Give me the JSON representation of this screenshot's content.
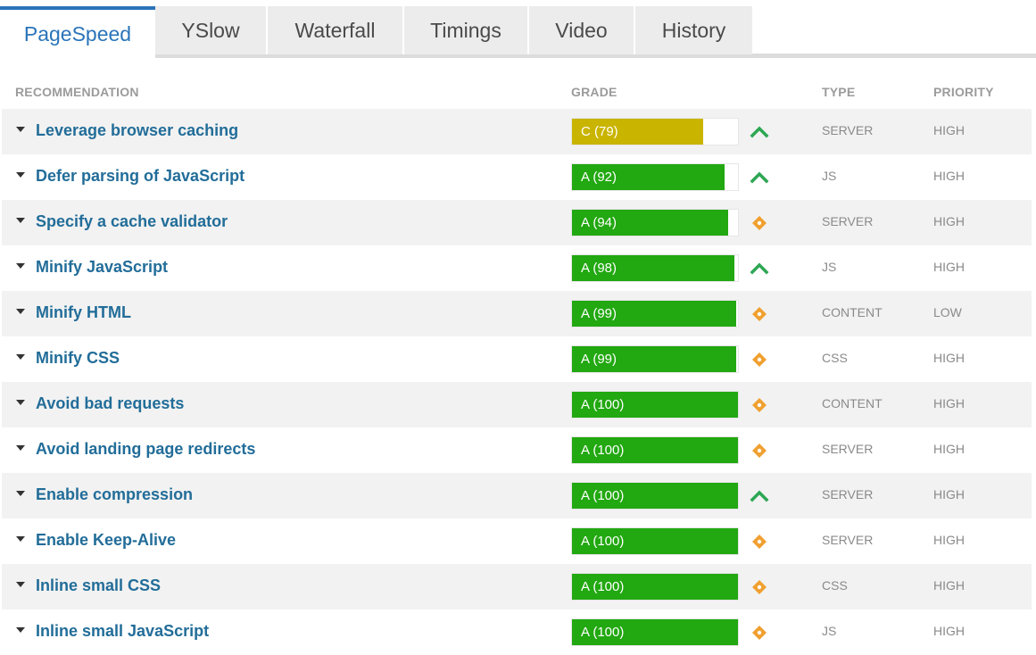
{
  "tabs": [
    {
      "label": "PageSpeed",
      "active": true
    },
    {
      "label": "YSlow",
      "active": false
    },
    {
      "label": "Waterfall",
      "active": false
    },
    {
      "label": "Timings",
      "active": false
    },
    {
      "label": "Video",
      "active": false
    },
    {
      "label": "History",
      "active": false
    }
  ],
  "table": {
    "headers": {
      "recommendation": "RECOMMENDATION",
      "grade": "GRADE",
      "type": "TYPE",
      "priority": "PRIORITY"
    },
    "rows": [
      {
        "recommendation": "Leverage browser caching",
        "grade_label": "C (79)",
        "score": 79,
        "grade_color": "#c9b400",
        "trend": "up",
        "type": "SERVER",
        "priority": "HIGH"
      },
      {
        "recommendation": "Defer parsing of JavaScript",
        "grade_label": "A (92)",
        "score": 92,
        "grade_color": "#22a811",
        "trend": "up",
        "type": "JS",
        "priority": "HIGH"
      },
      {
        "recommendation": "Specify a cache validator",
        "grade_label": "A (94)",
        "score": 94,
        "grade_color": "#22a811",
        "trend": "neutral",
        "type": "SERVER",
        "priority": "HIGH"
      },
      {
        "recommendation": "Minify JavaScript",
        "grade_label": "A (98)",
        "score": 98,
        "grade_color": "#22a811",
        "trend": "up",
        "type": "JS",
        "priority": "HIGH"
      },
      {
        "recommendation": "Minify HTML",
        "grade_label": "A (99)",
        "score": 99,
        "grade_color": "#22a811",
        "trend": "neutral",
        "type": "CONTENT",
        "priority": "LOW"
      },
      {
        "recommendation": "Minify CSS",
        "grade_label": "A (99)",
        "score": 99,
        "grade_color": "#22a811",
        "trend": "neutral",
        "type": "CSS",
        "priority": "HIGH"
      },
      {
        "recommendation": "Avoid bad requests",
        "grade_label": "A (100)",
        "score": 100,
        "grade_color": "#22a811",
        "trend": "neutral",
        "type": "CONTENT",
        "priority": "HIGH"
      },
      {
        "recommendation": "Avoid landing page redirects",
        "grade_label": "A (100)",
        "score": 100,
        "grade_color": "#22a811",
        "trend": "neutral",
        "type": "SERVER",
        "priority": "HIGH"
      },
      {
        "recommendation": "Enable compression",
        "grade_label": "A (100)",
        "score": 100,
        "grade_color": "#22a811",
        "trend": "up",
        "type": "SERVER",
        "priority": "HIGH"
      },
      {
        "recommendation": "Enable Keep-Alive",
        "grade_label": "A (100)",
        "score": 100,
        "grade_color": "#22a811",
        "trend": "neutral",
        "type": "SERVER",
        "priority": "HIGH"
      },
      {
        "recommendation": "Inline small CSS",
        "grade_label": "A (100)",
        "score": 100,
        "grade_color": "#22a811",
        "trend": "neutral",
        "type": "CSS",
        "priority": "HIGH"
      },
      {
        "recommendation": "Inline small JavaScript",
        "grade_label": "A (100)",
        "score": 100,
        "grade_color": "#22a811",
        "trend": "neutral",
        "type": "JS",
        "priority": "HIGH"
      }
    ]
  },
  "icons": {
    "up": "trend-up-icon",
    "neutral": "trend-neutral-icon",
    "expand": "caret-down-icon"
  },
  "colors": {
    "accent": "#2a74b9",
    "link": "#226d99",
    "trend_up": "#2da653",
    "trend_neutral": "#f0a030"
  }
}
